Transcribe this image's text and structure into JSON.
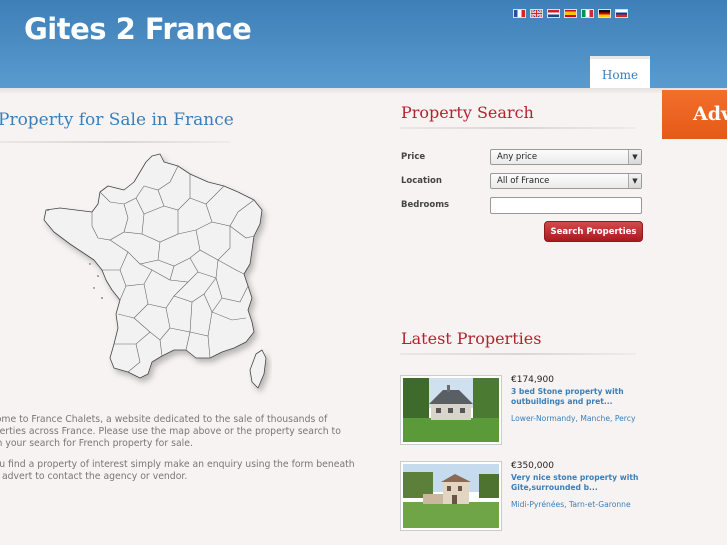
{
  "header": {
    "logo": "Gites 2 France",
    "languages": [
      "French",
      "English",
      "Dutch",
      "Spanish",
      "Italian",
      "German",
      "Russian"
    ],
    "nav": {
      "home": "Home"
    }
  },
  "main": {
    "title": "Property for Sale in France",
    "intro": [
      "lcome to France Chalets, a website dedicated to the sale of thousands of",
      "operties across France. Please use the map above or the property search to",
      "gin your search for French property for sale.",
      "you find a property of interest simply make an enquiry using the form beneath",
      "ch advert to contact the agency or vendor."
    ]
  },
  "search": {
    "title": "Property Search",
    "price_label": "Price",
    "price_value": "Any price",
    "location_label": "Location",
    "location_value": "All of France",
    "bedrooms_label": "Bedrooms",
    "bedrooms_value": "",
    "button": "Search Properties"
  },
  "advert": {
    "text": "Adv"
  },
  "latest": {
    "title": "Latest Properties",
    "items": [
      {
        "price": "€174,900",
        "title_line1": "3 bed Stone property with",
        "title_line2": "outbuildings and pret...",
        "location": "Lower-Normandy, Manche, Percy"
      },
      {
        "price": "€350,000",
        "title_line1": "Very nice stone property with",
        "title_line2": "Gite,surrounded b...",
        "location": "Midi-Pyrénées, Tarn-et-Garonne"
      }
    ]
  }
}
